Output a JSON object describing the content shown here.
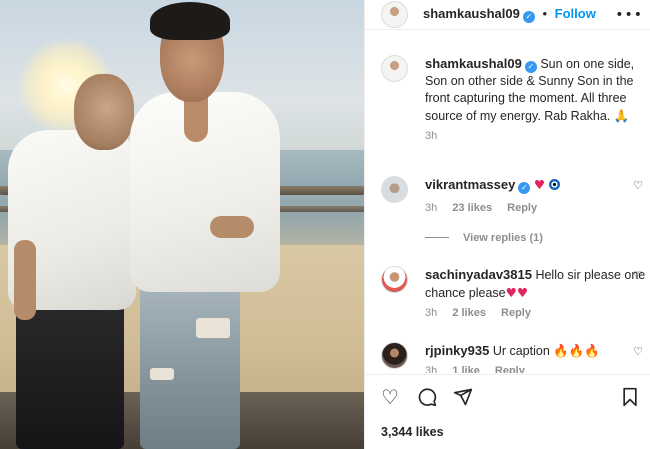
{
  "post": {
    "owner": "shamkaushal09",
    "follow_label": "Follow",
    "more_icon": "•••",
    "caption": "Sun on one side, Son on other side & Sunny Son in the front capturing the moment. All three source of my energy. Rab Rakha.",
    "caption_time": "3h",
    "likes": "3,344 likes"
  },
  "comments": [
    {
      "username": "vikrantmassey",
      "time": "3h",
      "likes": "23 likes",
      "reply": "Reply",
      "view_replies": "View replies (1)"
    },
    {
      "username": "sachinyadav3815",
      "text": "Hello sir please one chance please",
      "time": "3h",
      "likes": "2 likes",
      "reply": "Reply"
    },
    {
      "username": "rjpinky935",
      "text": "Ur caption",
      "time": "3h",
      "likes": "1 like",
      "reply": "Reply"
    }
  ],
  "icons": {
    "heart": "heart-icon",
    "comment": "comment-icon",
    "share": "paper-plane-icon",
    "save": "bookmark-icon"
  },
  "colors": {
    "link": "#0095f6",
    "verified": "#3897f0",
    "muted": "#8e8e8e"
  }
}
